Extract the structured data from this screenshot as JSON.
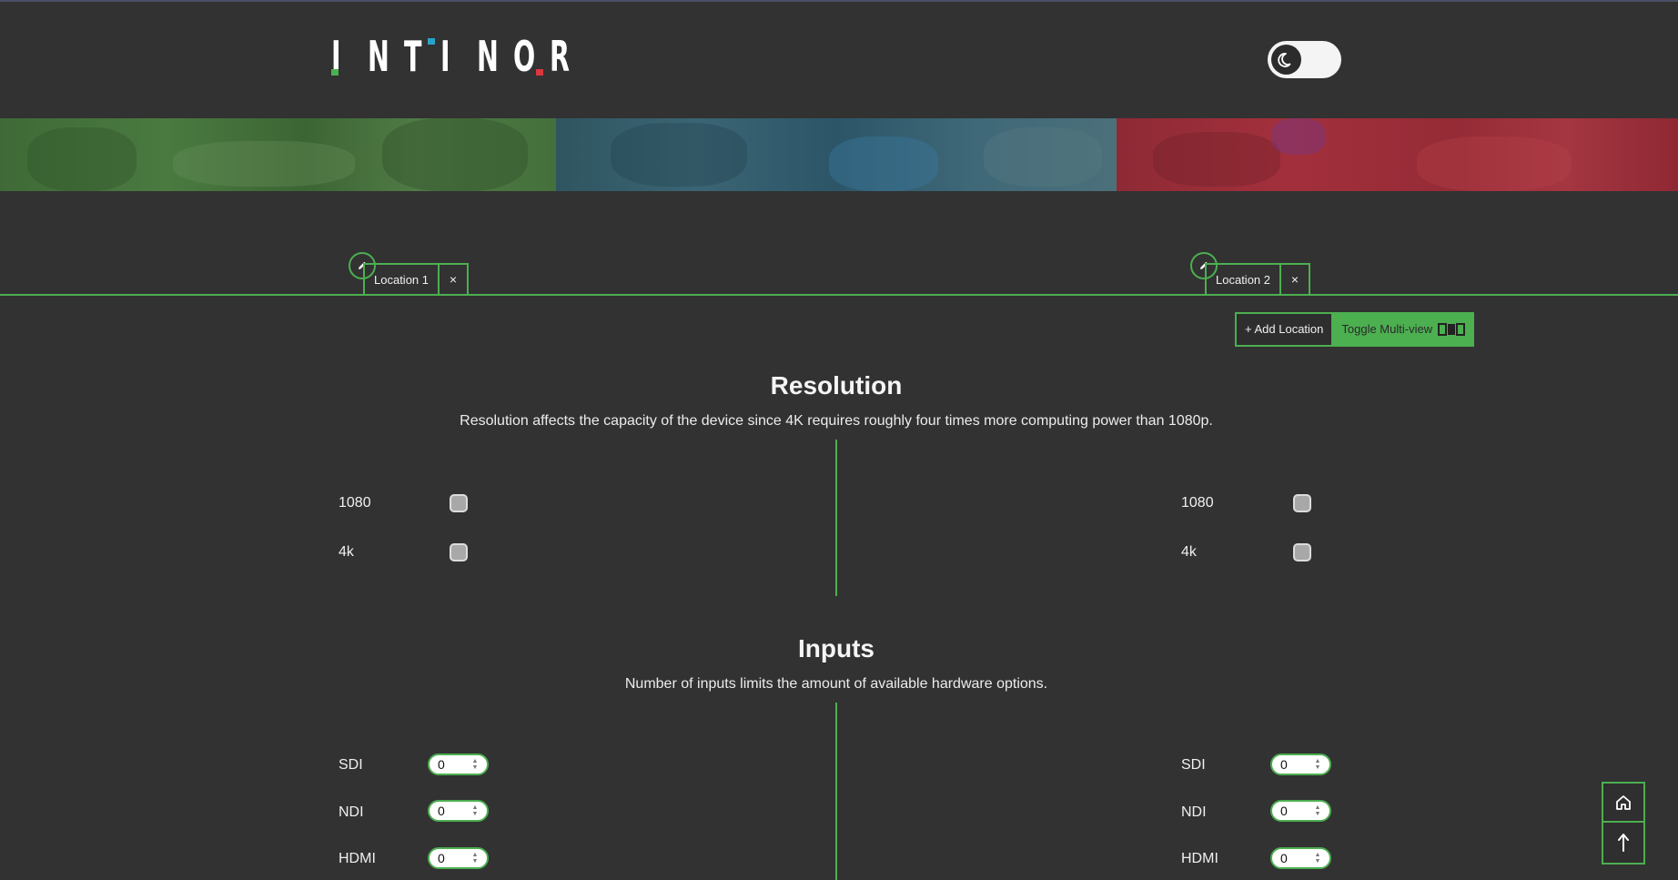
{
  "header": {
    "logo": [
      "I",
      "N",
      "T",
      "I",
      "N",
      "O",
      "R"
    ],
    "theme_toggle": {
      "icon": "moon-icon",
      "state": "dark"
    }
  },
  "banner": {
    "panels": [
      "green-house-photo",
      "blue-hands-photo",
      "red-rocks-photo"
    ]
  },
  "tabs": [
    {
      "label": "Location 1",
      "close": "×"
    },
    {
      "label": "Location 2",
      "close": "×"
    }
  ],
  "actions": {
    "add_location": "+ Add Location",
    "toggle_multiview": "Toggle Multi-view"
  },
  "resolution": {
    "title": "Resolution",
    "description": "Resolution affects the capacity of the device since 4K requires roughly four times more computing power than 1080p.",
    "options": [
      "1080",
      "4k"
    ]
  },
  "inputs": {
    "title": "Inputs",
    "description": "Number of inputs limits the amount of available hardware options.",
    "fields": [
      {
        "label": "SDI",
        "value": "0"
      },
      {
        "label": "NDI",
        "value": "0"
      },
      {
        "label": "HDMI",
        "value": "0"
      }
    ]
  },
  "colors": {
    "accent": "#4caf50",
    "background": "#323232",
    "logo_green": "#4caf50",
    "logo_blue": "#29a3c9",
    "logo_red": "#d9363e"
  }
}
